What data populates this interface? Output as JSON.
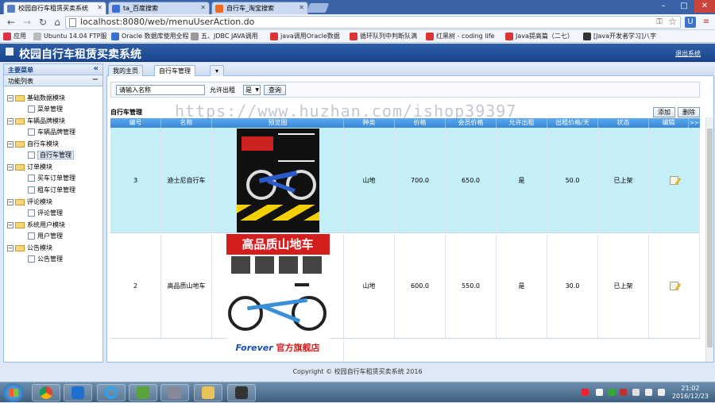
{
  "browser": {
    "tabs": [
      {
        "label": "校园自行车租赁买卖系统",
        "active": true
      },
      {
        "label": "ta_百度搜索",
        "active": false
      },
      {
        "label": "自行车_淘宝搜索",
        "active": false
      }
    ],
    "url": "localhost:8080/web/menuUserAction.do",
    "bookmarks": [
      "应用",
      "Ubuntu 14.04 FTP服",
      "Oracle 数据库使用全程",
      "五、JDBC JAVA调用",
      "java调用Oracle数据",
      "循环队列中判断队满",
      "红黑树 - coding life",
      "Java提高篇（二七）",
      "[Java开发者学习]八字"
    ]
  },
  "app": {
    "title": "校园自行车租赁买卖系统",
    "exit_label": "退出系统",
    "footer": "Copyright © 校园自行车租赁买卖系统 2016"
  },
  "sidebar": {
    "header": "主要菜单",
    "collapse_icon": "«",
    "section": "功能列表",
    "section_icon": "−",
    "groups": [
      {
        "label": "基础数据模块",
        "items": [
          "菜单管理"
        ]
      },
      {
        "label": "车辆品牌模块",
        "items": [
          "车辆品牌管理"
        ]
      },
      {
        "label": "自行车模块",
        "items": [
          "自行车管理"
        ]
      },
      {
        "label": "订单模块",
        "items": [
          "买车订单管理",
          "租车订单管理"
        ]
      },
      {
        "label": "评论模块",
        "items": [
          "评论管理"
        ]
      },
      {
        "label": "系统用户模块",
        "items": [
          "用户管理"
        ]
      },
      {
        "label": "公告模块",
        "items": [
          "公告管理"
        ]
      }
    ]
  },
  "tabs": [
    {
      "label": "我的主页",
      "active": false
    },
    {
      "label": "自行车管理",
      "active": true
    },
    {
      "label": "▾",
      "active": false
    }
  ],
  "filters": {
    "name_placeholder": "请输入名称",
    "rent_label": "允许出租",
    "rent_value": "是",
    "search_label": "查询"
  },
  "grid": {
    "title": "自行车管理",
    "add_label": "添加",
    "delete_label": "删除",
    "more_icon": ">>",
    "columns": [
      "编号",
      "名称",
      "预览图",
      "种类",
      "价格",
      "会员价格",
      "允许出租",
      "出租价格/天",
      "状态",
      "编辑"
    ],
    "rows": [
      {
        "id": "3",
        "name": "迪士尼自行车",
        "type": "山地",
        "price": "700.0",
        "member_price": "650.0",
        "rent": "是",
        "rent_price": "50.0",
        "status": "已上架"
      },
      {
        "id": "2",
        "name": "高品质山地车",
        "type": "山地",
        "price": "600.0",
        "member_price": "550.0",
        "rent": "是",
        "rent_price": "30.0",
        "status": "已上架"
      }
    ],
    "product_banners": [
      "高品质山地车",
      "官方旗舰店"
    ],
    "product_brand": "Forever"
  },
  "watermark": "https://www.huzhan.com/ishop39397",
  "taskbar": {
    "time": "21:02",
    "date": "2016/12/23"
  },
  "colors": {
    "header_blue": "#1f4f98",
    "highlight_row": "#c4eff6",
    "grid_head": "#4a97e6"
  }
}
